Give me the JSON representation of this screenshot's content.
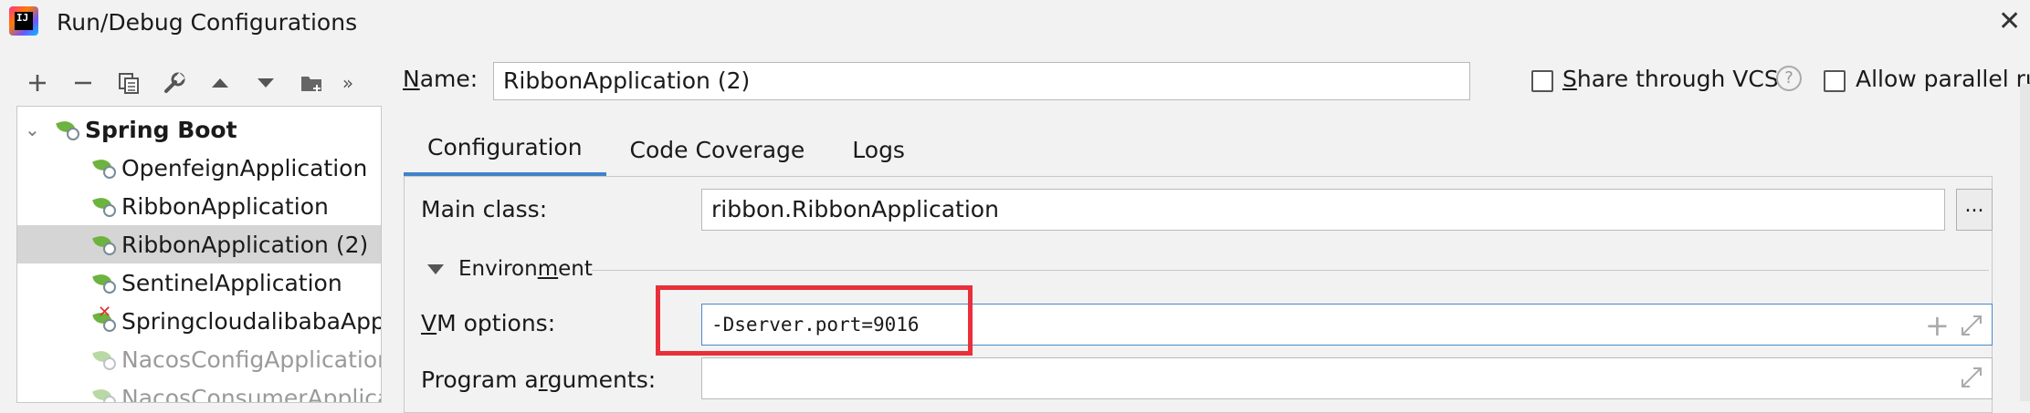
{
  "window": {
    "title": "Run/Debug Configurations"
  },
  "toolbar": {
    "buttons": [
      "add-icon",
      "remove-icon",
      "copy-icon",
      "wrench-icon",
      "arrow-up-icon",
      "arrow-down-icon",
      "folder-add-icon",
      "more-icon"
    ]
  },
  "tree": {
    "group": "Spring Boot",
    "items": [
      {
        "label": "OpenfeignApplication",
        "selected": false,
        "dim": false,
        "error": false
      },
      {
        "label": "RibbonApplication",
        "selected": false,
        "dim": false,
        "error": false
      },
      {
        "label": "RibbonApplication (2)",
        "selected": true,
        "dim": false,
        "error": false
      },
      {
        "label": "SentinelApplication",
        "selected": false,
        "dim": false,
        "error": false
      },
      {
        "label": "SpringcloudalibabaApplic",
        "selected": false,
        "dim": false,
        "error": true
      },
      {
        "label": "NacosConfigApplication",
        "selected": false,
        "dim": true,
        "error": false
      },
      {
        "label": "NacosConsumerApplicat",
        "selected": false,
        "dim": true,
        "error": false
      }
    ]
  },
  "header": {
    "name_label_first": "N",
    "name_label_rest": "ame:",
    "name_value": "RibbonApplication (2)",
    "share_first": "S",
    "share_rest": "hare through VCS",
    "help": "?",
    "parallel_label": "Allow parallel ru"
  },
  "tabs": [
    "Configuration",
    "Code Coverage",
    "Logs"
  ],
  "form": {
    "main_class_label": "Main class:",
    "main_class_value": "ribbon.RibbonApplication",
    "browse_label": "...",
    "environment_pre": "Environ",
    "environment_u": "m",
    "environment_post": "ent",
    "vm_label_first": "V",
    "vm_label_rest": "M options:",
    "vm_value": "-Dserver.port=9016",
    "program_pre": "Program a",
    "program_u": "r",
    "program_post": "guments:",
    "plus": "+"
  },
  "colors": {
    "accent": "#4083c9",
    "highlight": "#e8303a",
    "spring": "#6db33f"
  }
}
